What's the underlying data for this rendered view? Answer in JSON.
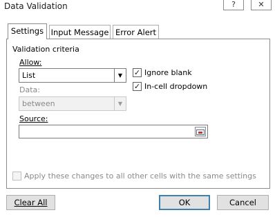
{
  "window": {
    "title": "Data Validation",
    "help_glyph": "?",
    "close_glyph": "✕"
  },
  "tabs": [
    {
      "label": "Settings",
      "active": true
    },
    {
      "label": "Input Message",
      "active": false
    },
    {
      "label": "Error Alert",
      "active": false
    }
  ],
  "settings": {
    "group_label": "Validation criteria",
    "allow": {
      "label": "Allow:",
      "value": "List"
    },
    "ignore_blank": {
      "label": "Ignore blank",
      "checked": true
    },
    "in_cell_dropdown": {
      "label": "In-cell dropdown",
      "checked": true
    },
    "data": {
      "label": "Data:",
      "value": "between",
      "enabled": false
    },
    "source": {
      "label": "Source:",
      "value": ""
    },
    "apply_all": {
      "label": "Apply these changes to all other cells with the same settings",
      "checked": false,
      "enabled": false
    }
  },
  "buttons": {
    "clear_all": "Clear All",
    "ok": "OK",
    "cancel": "Cancel"
  },
  "icons": {
    "dropdown": "chevron-down-icon",
    "checkmark": "checkmark-icon",
    "range_selector": "collapse-dialog-icon"
  },
  "colors": {
    "default_button_border": "#3c7fb1",
    "button_face": "#e1e1e1",
    "panel_border": "#8c8c8c"
  }
}
